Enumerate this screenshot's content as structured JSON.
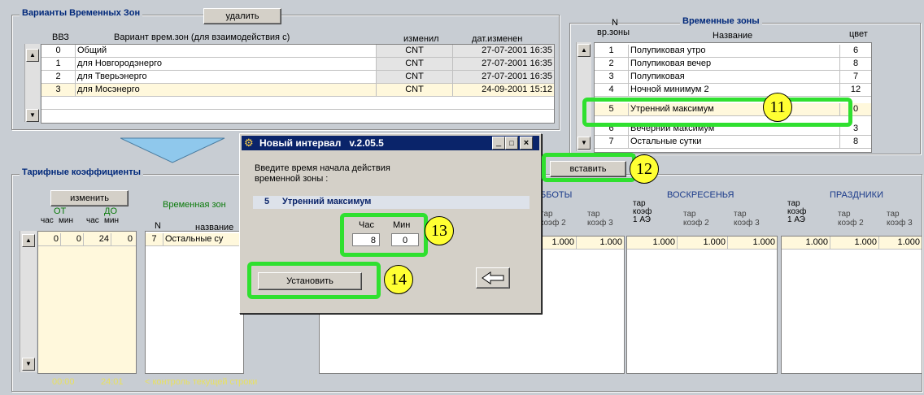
{
  "variants": {
    "title": "Варианты Временных Зон",
    "delete_label": "удалить",
    "headers": {
      "vvz": "ВВЗ",
      "variant": "Вариант врем.зон (для взаимодействия с)",
      "changed_by": "изменил",
      "changed_at": "дат.изменен"
    },
    "rows": [
      {
        "vvz": "0",
        "name": "Общий",
        "by": "CNT",
        "at": "27-07-2001 16:35"
      },
      {
        "vvz": "1",
        "name": "для Новгородэнерго",
        "by": "CNT",
        "at": "27-07-2001 16:35"
      },
      {
        "vvz": "2",
        "name": "для Тверьэнерго",
        "by": "CNT",
        "at": "27-07-2001 16:35"
      },
      {
        "vvz": "3",
        "name": "для Мосэнерго",
        "by": "CNT",
        "at": "24-09-2001 15:12"
      }
    ]
  },
  "zones": {
    "title": "Временные зоны",
    "headers": {
      "n_top": "N",
      "n_bottom": "вр.зоны",
      "name": "Название",
      "color": "цвет"
    },
    "rows": [
      {
        "n": "1",
        "name": "Полупиковая утро",
        "color": "6"
      },
      {
        "n": "2",
        "name": "Полупиковая вечер",
        "color": "8"
      },
      {
        "n": "3",
        "name": "Полупиковая",
        "color": "7"
      },
      {
        "n": "4",
        "name": "Ночной минимум 2",
        "color": "12"
      },
      {
        "n": "5",
        "name": "Утренний максимум",
        "color": "0"
      },
      {
        "n": "6",
        "name": "Вечерний максимум",
        "color": "3"
      },
      {
        "n": "7",
        "name": "Остальные сутки",
        "color": "8"
      }
    ],
    "insert_label": "вставить"
  },
  "tariff": {
    "title": "Тарифные коэффициенты",
    "change_label": "изменить",
    "from_label": "ОТ",
    "to_label": "ДО",
    "hour": "час",
    "min": "мин",
    "zone_label": "Временная зон",
    "n_label": "N",
    "name_label": "название",
    "row": {
      "from_h": "0",
      "from_m": "0",
      "to_h": "24",
      "to_m": "0",
      "n": "7",
      "name": "Остальные су"
    },
    "saturdays_label": "ББОТЫ",
    "sundays_label": "ВОСКРЕСЕНЬЯ",
    "holidays_label": "ПРАЗДНИКИ",
    "coef1": "тар коэф 1 АЭ",
    "coef2": "тар коэф 2",
    "coef3": "тар коэф 3",
    "value": "1.000",
    "footer_from": "00:00",
    "footer_to": "24:01",
    "footer_hint": "< контроль текущей строки"
  },
  "dialog": {
    "title": "Новый интервал   v.2.05.5",
    "prompt": "Введите время начала действия временной зоны :",
    "zone_num": "5",
    "zone_name": "Утренний максимум",
    "hour_label": "Час",
    "min_label": "Мин",
    "hour_value": "8",
    "min_value": "0",
    "set_label": "Установить"
  },
  "callouts": [
    "11",
    "12",
    "13",
    "14"
  ],
  "colors": {
    "highlight": "#2fe02f",
    "selected_row": "#fff8dc",
    "title_blue": "#00287a",
    "dialog_title": "#0a246a"
  }
}
